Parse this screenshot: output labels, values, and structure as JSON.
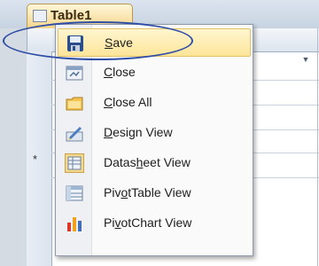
{
  "window": {
    "tab_title": "Table1",
    "new_record_marker": "*"
  },
  "context_menu": {
    "items": [
      {
        "label_pre": "",
        "label_key": "S",
        "label_post": "ave",
        "icon": "save-icon",
        "highlighted": true
      },
      {
        "label_pre": "",
        "label_key": "C",
        "label_post": "lose",
        "icon": "close-form-icon",
        "highlighted": false
      },
      {
        "label_pre": "",
        "label_key": "C",
        "label_post": "lose All",
        "icon": "close-all-icon",
        "highlighted": false
      },
      {
        "label_pre": "",
        "label_key": "D",
        "label_post": "esign View",
        "icon": "design-view-icon",
        "highlighted": false
      },
      {
        "label_pre": "Datas",
        "label_key": "h",
        "label_post": "eet View",
        "icon": "datasheet-view-icon",
        "highlighted": false
      },
      {
        "label_pre": "Piv",
        "label_key": "o",
        "label_post": "tTable View",
        "icon": "pivottable-view-icon",
        "highlighted": false
      },
      {
        "label_pre": "Pi",
        "label_key": "v",
        "label_post": "otChart View",
        "icon": "pivotchart-view-icon",
        "highlighted": false
      }
    ]
  },
  "colors": {
    "highlight_fill": "#fde59a",
    "annotation_ellipse": "#2f4fa6"
  }
}
